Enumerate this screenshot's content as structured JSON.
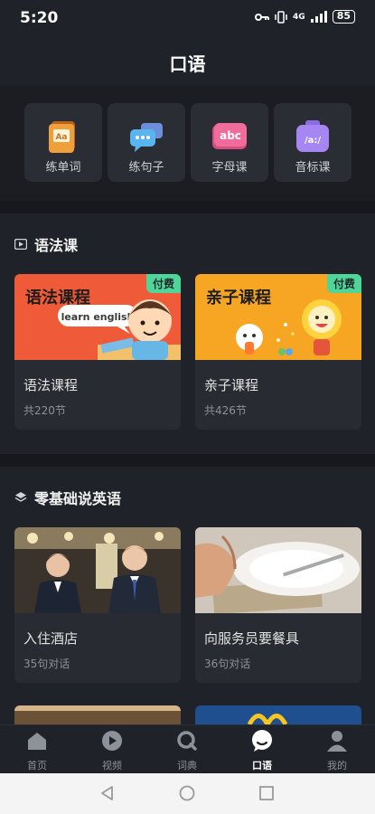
{
  "status": {
    "time": "5:20",
    "network": "4G",
    "battery": "85"
  },
  "header": {
    "title": "口语"
  },
  "quick": [
    {
      "label": "练单词",
      "icon": "flashcard-icon",
      "glyph": "Aa"
    },
    {
      "label": "练句子",
      "icon": "chat-bubble-icon",
      "glyph": "···"
    },
    {
      "label": "字母课",
      "icon": "abc-icon",
      "glyph": "abc"
    },
    {
      "label": "音标课",
      "icon": "phonetic-icon",
      "glyph": "/a:/"
    }
  ],
  "grammar": {
    "title": "语法课",
    "cards": [
      {
        "thumb_title": "语法课程",
        "bubble": "learn english",
        "badge": "付费",
        "title": "语法课程",
        "sub": "共220节"
      },
      {
        "thumb_title": "亲子课程",
        "badge": "付费",
        "title": "亲子课程",
        "sub": "共426节"
      }
    ]
  },
  "zero": {
    "title": "零基础说英语",
    "cards": [
      {
        "title": "入住酒店",
        "sub": "35句对话"
      },
      {
        "title": "向服务员要餐具",
        "sub": "36句对话"
      }
    ]
  },
  "tabs": [
    {
      "label": "首页",
      "icon": "home-icon"
    },
    {
      "label": "视频",
      "icon": "video-icon"
    },
    {
      "label": "词典",
      "icon": "dictionary-icon"
    },
    {
      "label": "口语",
      "icon": "speech-icon",
      "active": true
    },
    {
      "label": "我的",
      "icon": "profile-icon"
    }
  ],
  "colors": {
    "accent": "#4fd59a",
    "background": "#1f2228"
  }
}
